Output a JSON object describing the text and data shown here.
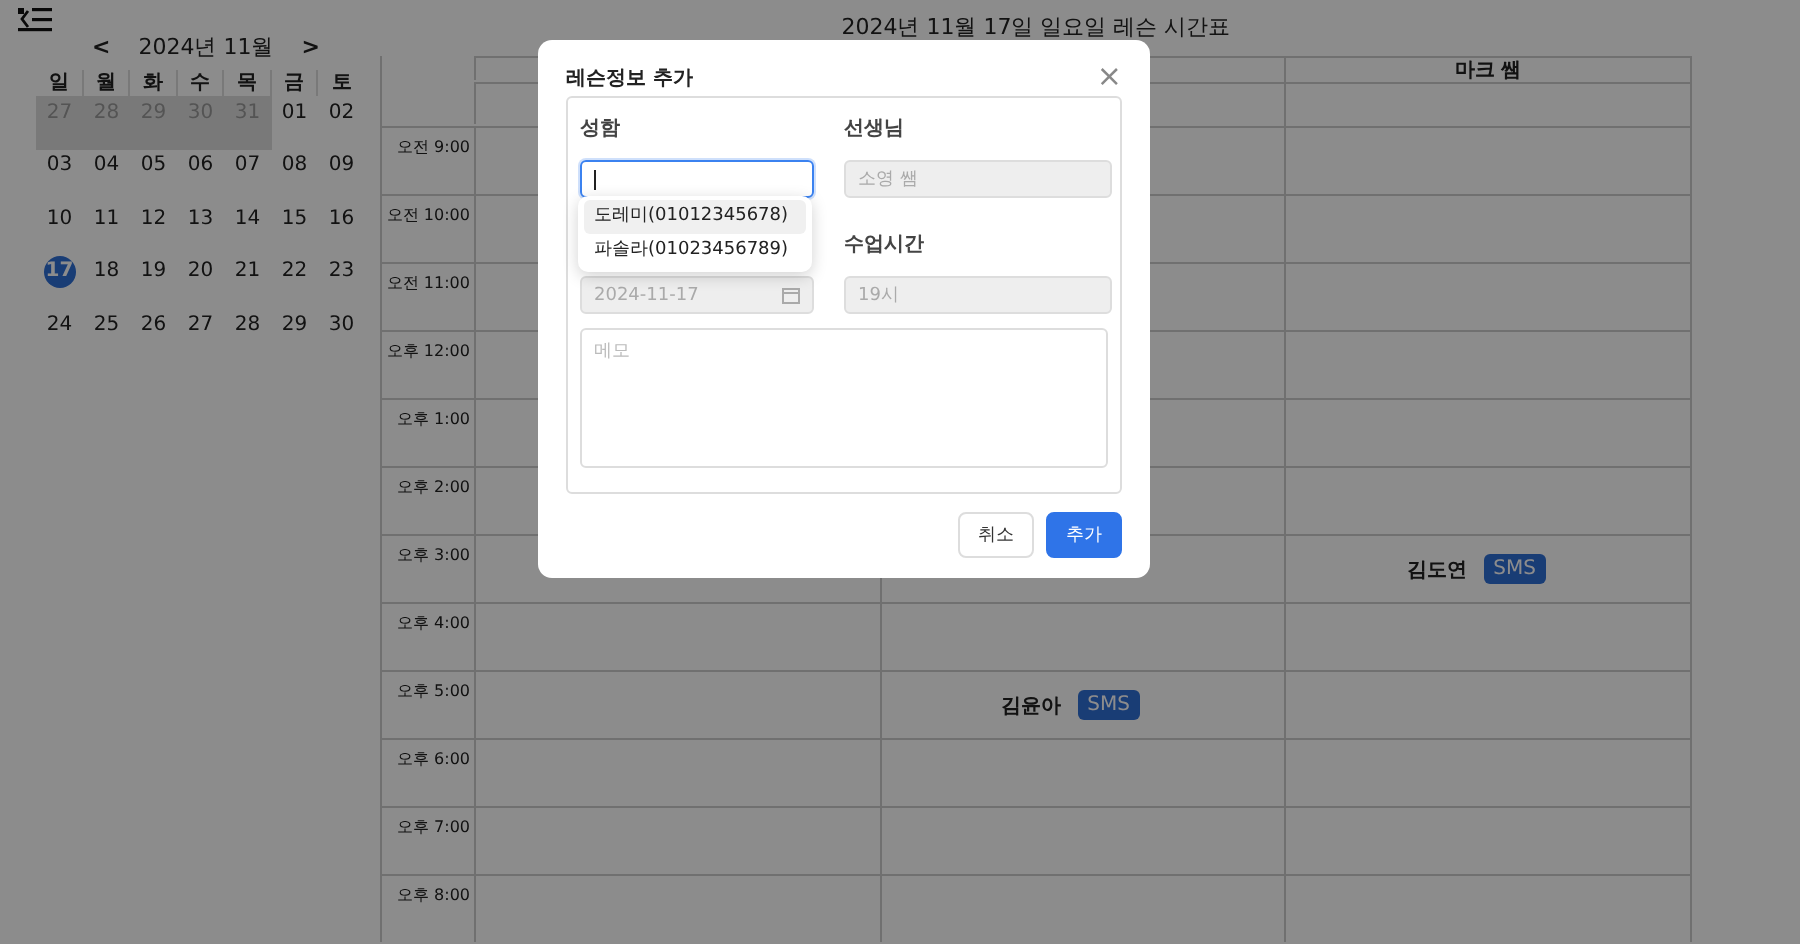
{
  "calendar": {
    "prev": "<",
    "month_label": "2024년 11월",
    "next": ">",
    "weekdays": [
      "일",
      "월",
      "화",
      "수",
      "목",
      "금",
      "토"
    ],
    "weeks": [
      [
        {
          "day": "27",
          "outside": true,
          "selected": false
        },
        {
          "day": "28",
          "outside": true,
          "selected": false
        },
        {
          "day": "29",
          "outside": true,
          "selected": false
        },
        {
          "day": "30",
          "outside": true,
          "selected": false
        },
        {
          "day": "31",
          "outside": true,
          "selected": false
        },
        {
          "day": "01",
          "outside": false,
          "selected": false
        },
        {
          "day": "02",
          "outside": false,
          "selected": false
        }
      ],
      [
        {
          "day": "03",
          "outside": false,
          "selected": false
        },
        {
          "day": "04",
          "outside": false,
          "selected": false
        },
        {
          "day": "05",
          "outside": false,
          "selected": false
        },
        {
          "day": "06",
          "outside": false,
          "selected": false
        },
        {
          "day": "07",
          "outside": false,
          "selected": false
        },
        {
          "day": "08",
          "outside": false,
          "selected": false
        },
        {
          "day": "09",
          "outside": false,
          "selected": false
        }
      ],
      [
        {
          "day": "10",
          "outside": false,
          "selected": false
        },
        {
          "day": "11",
          "outside": false,
          "selected": false
        },
        {
          "day": "12",
          "outside": false,
          "selected": false
        },
        {
          "day": "13",
          "outside": false,
          "selected": false
        },
        {
          "day": "14",
          "outside": false,
          "selected": false
        },
        {
          "day": "15",
          "outside": false,
          "selected": false
        },
        {
          "day": "16",
          "outside": false,
          "selected": false
        }
      ],
      [
        {
          "day": "17",
          "outside": false,
          "selected": true
        },
        {
          "day": "18",
          "outside": false,
          "selected": false
        },
        {
          "day": "19",
          "outside": false,
          "selected": false
        },
        {
          "day": "20",
          "outside": false,
          "selected": false
        },
        {
          "day": "21",
          "outside": false,
          "selected": false
        },
        {
          "day": "22",
          "outside": false,
          "selected": false
        },
        {
          "day": "23",
          "outside": false,
          "selected": false
        }
      ],
      [
        {
          "day": "24",
          "outside": false,
          "selected": false
        },
        {
          "day": "25",
          "outside": false,
          "selected": false
        },
        {
          "day": "26",
          "outside": false,
          "selected": false
        },
        {
          "day": "27",
          "outside": false,
          "selected": false
        },
        {
          "day": "28",
          "outside": false,
          "selected": false
        },
        {
          "day": "29",
          "outside": false,
          "selected": false
        },
        {
          "day": "30",
          "outside": false,
          "selected": false
        }
      ]
    ]
  },
  "schedule": {
    "title": "2024년 11월 17일 일요일 레슨 시간표",
    "column_3": {
      "header": "마크 쌤"
    },
    "rows": [
      {
        "time": "오전 9:00"
      },
      {
        "time": "오전 10:00"
      },
      {
        "time": "오전 11:00"
      },
      {
        "time": "오후 12:00"
      },
      {
        "time": "오후 1:00"
      },
      {
        "time": "오후 2:00"
      },
      {
        "time": "오후 3:00",
        "column_3": {
          "name": "김도연",
          "action": "SMS"
        }
      },
      {
        "time": "오후 4:00"
      },
      {
        "time": "오후 5:00",
        "column_2": {
          "name": "김윤아",
          "action": "SMS"
        }
      },
      {
        "time": "오후 6:00"
      },
      {
        "time": "오후 7:00"
      },
      {
        "time": "오후 8:00"
      }
    ]
  },
  "dialog": {
    "title": "레슨정보 추가",
    "close": "×",
    "name_field": {
      "label": "성함",
      "focused": true
    },
    "teacher_field": {
      "label": "선생님",
      "value": "소영 쌤",
      "disabled": true
    },
    "suggestions": [
      {
        "text": "도레미(01012345678)",
        "selected": true
      },
      {
        "text": "파솔라(01023456789)",
        "selected": false
      }
    ],
    "date_field": {
      "value": "2024-11-17",
      "disabled": true
    },
    "time_field": {
      "label": "수업시간",
      "value": "19시",
      "disabled": true
    },
    "memo_field": {
      "placeholder": "메모"
    },
    "buttons": [
      {
        "label": "취소",
        "kind": "secondary"
      },
      {
        "label": "추가",
        "kind": "primary"
      }
    ]
  }
}
